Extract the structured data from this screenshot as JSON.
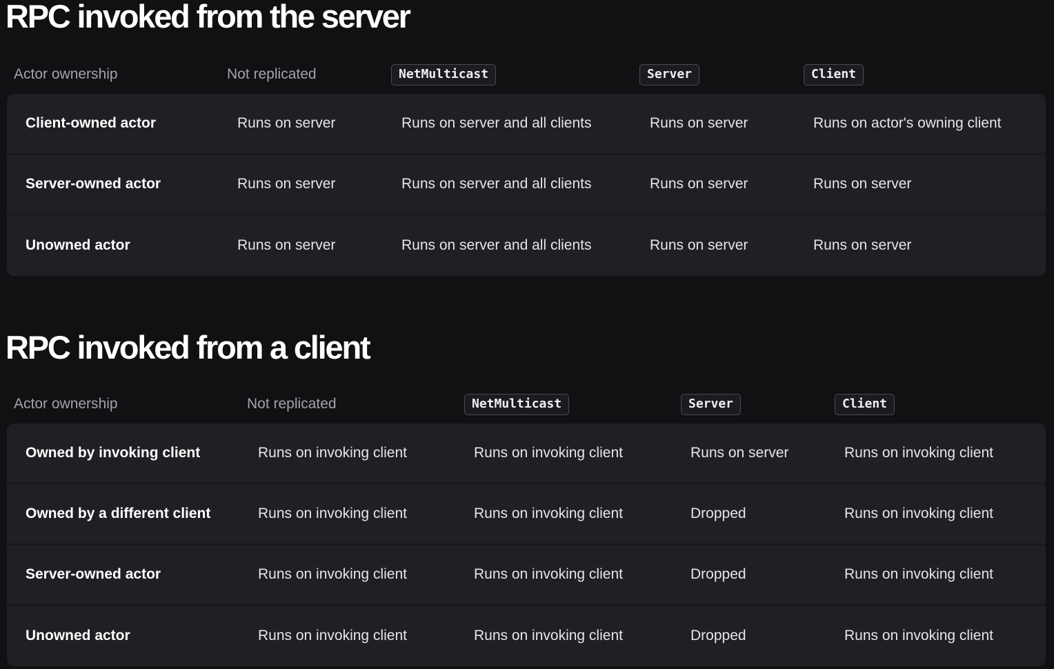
{
  "server_section": {
    "title": "RPC invoked from the server",
    "headers": [
      "Actor ownership",
      "Not replicated",
      "NetMulticast",
      "Server",
      "Client"
    ],
    "rows": [
      [
        "Client-owned actor",
        "Runs on server",
        "Runs on server and all clients",
        "Runs on server",
        "Runs on actor's owning client"
      ],
      [
        "Server-owned actor",
        "Runs on server",
        "Runs on server and all clients",
        "Runs on server",
        "Runs on server"
      ],
      [
        "Unowned actor",
        "Runs on server",
        "Runs on server and all clients",
        "Runs on server",
        "Runs on server"
      ]
    ]
  },
  "client_section": {
    "title": "RPC invoked from a client",
    "headers": [
      "Actor ownership",
      "Not replicated",
      "NetMulticast",
      "Server",
      "Client"
    ],
    "rows": [
      [
        "Owned by invoking client",
        "Runs on invoking client",
        "Runs on invoking client",
        "Runs on server",
        "Runs on invoking client"
      ],
      [
        "Owned by a different client",
        "Runs on invoking client",
        "Runs on invoking client",
        "Dropped",
        "Runs on invoking client"
      ],
      [
        "Server-owned actor",
        "Runs on invoking client",
        "Runs on invoking client",
        "Dropped",
        "Runs on invoking client"
      ],
      [
        "Unowned actor",
        "Runs on invoking client",
        "Runs on invoking client",
        "Dropped",
        "Runs on invoking client"
      ]
    ]
  }
}
